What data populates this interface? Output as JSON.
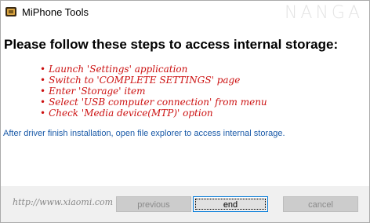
{
  "window": {
    "title": "MiPhone Tools",
    "watermark": "NANGA"
  },
  "content": {
    "heading": "Please follow these steps to access internal storage:",
    "steps": [
      "Launch 'Settings' application",
      "Switch to 'COMPLETE SETTINGS' page",
      "Enter 'Storage' item",
      "Select 'USB computer connection' from menu",
      "Check 'Media device(MTP)' option"
    ],
    "info": "After driver finish installation, open file explorer to access internal storage."
  },
  "footer": {
    "url": "http://www.xiaomi.com",
    "previous_label": "previous",
    "end_label": "end",
    "cancel_label": "cancel"
  },
  "colors": {
    "step_text": "#cc1111",
    "info_text": "#1a5aa8",
    "focus_border": "#0078d7"
  }
}
